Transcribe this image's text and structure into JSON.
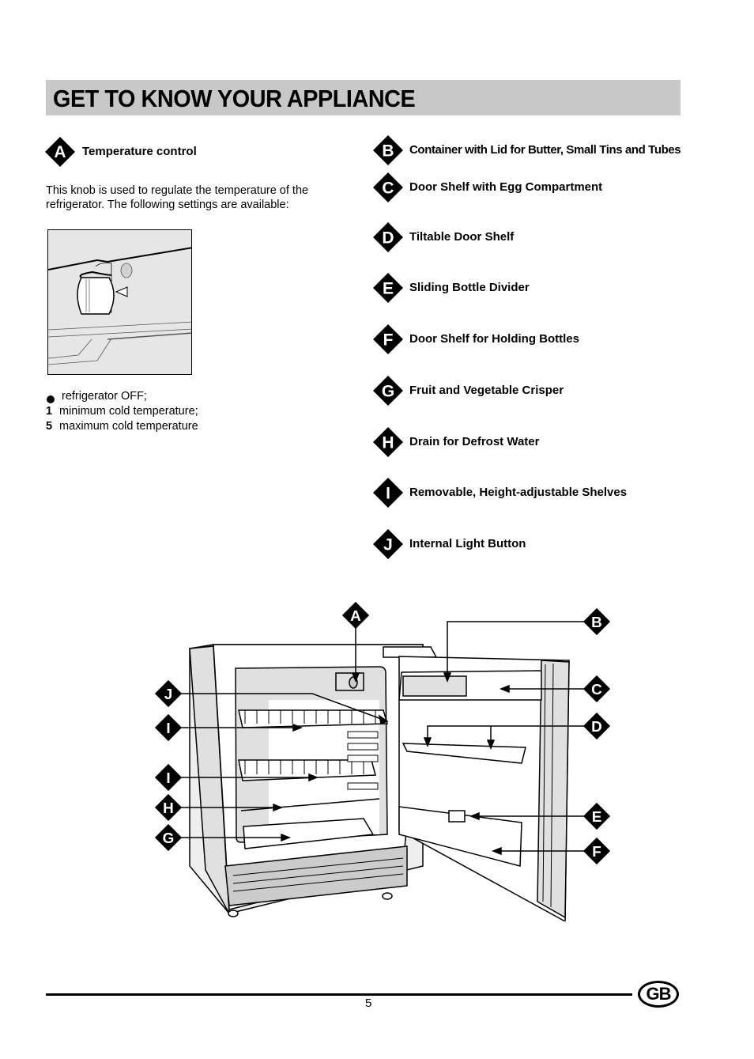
{
  "page": {
    "title": "GET TO KNOW YOUR APPLIANCE",
    "page_number": "5",
    "language_badge": "GB"
  },
  "temperature_control": {
    "letter": "A",
    "heading": "Temperature control",
    "description": "This knob is used to regulate the temperature of the refrigerator. The following settings are available:",
    "settings": [
      {
        "key": "dot-icon",
        "text": "refrigerator OFF;"
      },
      {
        "key": "1",
        "text": "minimum cold temperature;"
      },
      {
        "key": "5",
        "text": "maximum cold temperature"
      }
    ]
  },
  "components": [
    {
      "letter": "B",
      "label": "Container with Lid for Butter, Small Tins and Tubes"
    },
    {
      "letter": "C",
      "label": "Door Shelf with Egg Compartment"
    },
    {
      "letter": "D",
      "label": "Tiltable Door Shelf"
    },
    {
      "letter": "E",
      "label": "Sliding Bottle Divider"
    },
    {
      "letter": "F",
      "label": "Door Shelf for Holding Bottles"
    },
    {
      "letter": "G",
      "label": "Fruit and Vegetable Crisper"
    },
    {
      "letter": "H",
      "label": "Drain for Defrost Water"
    },
    {
      "letter": "I",
      "label": "Removable, Height-adjustable Shelves"
    },
    {
      "letter": "J",
      "label": "Internal Light Button"
    }
  ],
  "diagram": {
    "callouts_left": [
      "J",
      "I",
      "I",
      "H",
      "G"
    ],
    "callouts_right": [
      "B",
      "C",
      "D",
      "E",
      "F"
    ],
    "callout_top": "A"
  }
}
